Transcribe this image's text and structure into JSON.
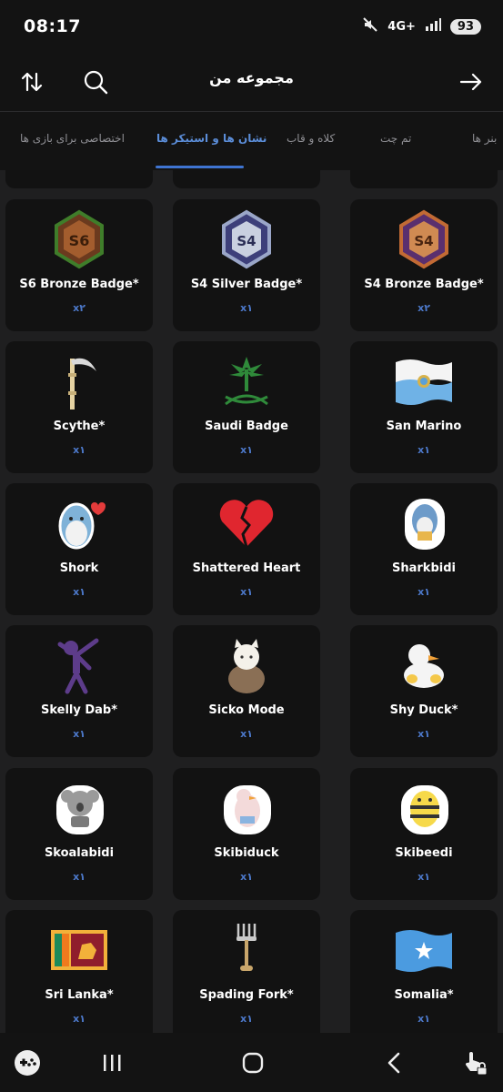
{
  "status": {
    "time": "08:17",
    "network": "4G+",
    "battery": "93"
  },
  "header": {
    "title": "مجموعه من"
  },
  "tabs": [
    {
      "label": "بنر ها",
      "active": false
    },
    {
      "label": "تم چت",
      "active": false
    },
    {
      "label": "کلاه و قاب",
      "active": false
    },
    {
      "label": "نشان ها و استیکر ها",
      "active": true
    },
    {
      "label": "اختصاصی برای بازی ها",
      "active": false
    }
  ],
  "items": [
    {
      "name": "S6 Bronze Badge*",
      "count": "x۲",
      "icon": "s6-bronze-badge-icon"
    },
    {
      "name": "S4 Silver Badge*",
      "count": "x۱",
      "icon": "s4-silver-badge-icon"
    },
    {
      "name": "S4 Bronze Badge*",
      "count": "x۲",
      "icon": "s4-bronze-badge-icon"
    },
    {
      "name": "Scythe*",
      "count": "x۱",
      "icon": "scythe-icon"
    },
    {
      "name": "Saudi Badge",
      "count": "x۱",
      "icon": "saudi-emblem-icon"
    },
    {
      "name": "San Marino",
      "count": "x۱",
      "icon": "san-marino-flag-icon"
    },
    {
      "name": "Shork",
      "count": "x۱",
      "icon": "shark-sticker-icon"
    },
    {
      "name": "Shattered Heart",
      "count": "x۱",
      "icon": "broken-heart-icon"
    },
    {
      "name": "Sharkbidi",
      "count": "x۱",
      "icon": "sharkbidi-sticker-icon"
    },
    {
      "name": "Skelly Dab*",
      "count": "x۱",
      "icon": "skeleton-dab-icon"
    },
    {
      "name": "Sicko Mode",
      "count": "x۱",
      "icon": "cat-sticker-icon"
    },
    {
      "name": "Shy Duck*",
      "count": "x۱",
      "icon": "duck-sticker-icon"
    },
    {
      "name": "Skoalabidi",
      "count": "x۱",
      "icon": "koala-sticker-icon"
    },
    {
      "name": "Skibiduck",
      "count": "x۱",
      "icon": "skibiduck-sticker-icon"
    },
    {
      "name": "Skibeedi",
      "count": "x۱",
      "icon": "bee-sticker-icon"
    },
    {
      "name": "Sri Lanka*",
      "count": "x۱",
      "icon": "sri-lanka-flag-icon"
    },
    {
      "name": "Spading Fork*",
      "count": "x۱",
      "icon": "pitchfork-icon"
    },
    {
      "name": "Somalia*",
      "count": "x۱",
      "icon": "somalia-flag-icon"
    }
  ],
  "colors": {
    "accent": "#3f74d1",
    "count": "#4c78c9",
    "card": "#121212",
    "background": "#1f1f20"
  }
}
